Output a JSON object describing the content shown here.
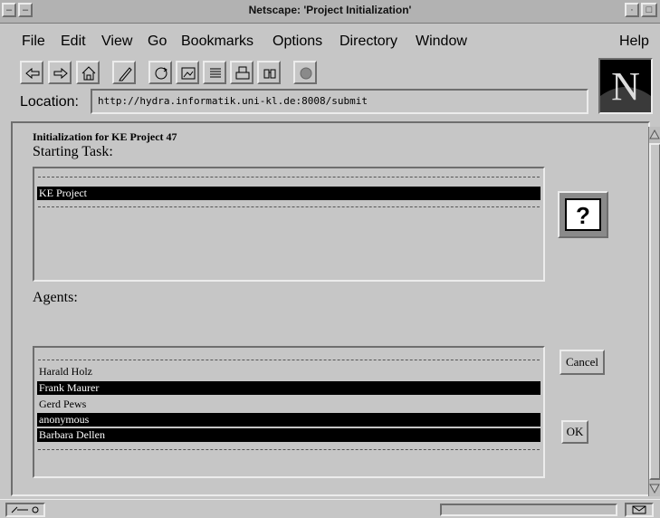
{
  "window": {
    "title": "Netscape: 'Project Initialization'"
  },
  "menu": {
    "items": [
      "File",
      "Edit",
      "View",
      "Go",
      "Bookmarks",
      "Options",
      "Directory",
      "Window"
    ],
    "help": "Help"
  },
  "toolbar": {
    "buttons": [
      "back-icon",
      "forward-icon",
      "home-icon",
      "edit-icon",
      "reload-icon",
      "images-icon",
      "open-icon",
      "print-icon",
      "find-icon",
      "stop-icon"
    ]
  },
  "location": {
    "label": "Location:",
    "url": "http://hydra.informatik.uni-kl.de:8008/submit"
  },
  "logo": {
    "letter": "N"
  },
  "page": {
    "heading": "Initialization for KE Project 47",
    "starting_task_label": "Starting Task:",
    "tasks": [
      {
        "label": "KE Project",
        "selected": true
      }
    ],
    "help_button": "?",
    "agents_label": "Agents:",
    "agents": [
      {
        "label": "Harald Holz",
        "selected": false
      },
      {
        "label": "Frank Maurer",
        "selected": true
      },
      {
        "label": "Gerd Pews",
        "selected": false
      },
      {
        "label": "anonymous",
        "selected": true
      },
      {
        "label": "Barbara Dellen",
        "selected": true
      }
    ],
    "cancel_button": "Cancel",
    "ok_button": "OK"
  },
  "colors": {
    "chrome": "#c6c6c6",
    "selection": "#000000",
    "selection_text": "#ffffff"
  }
}
